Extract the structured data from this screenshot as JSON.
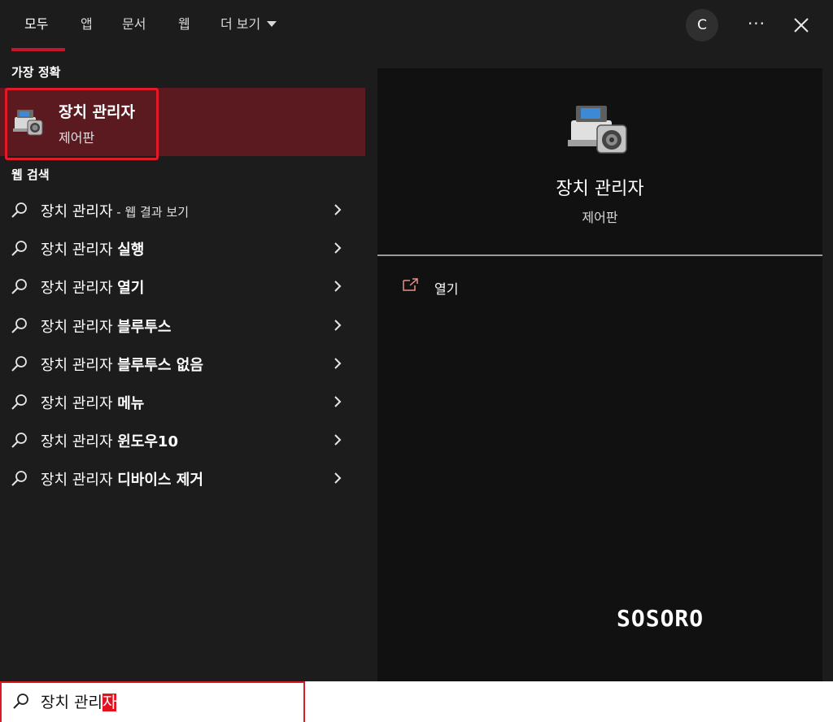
{
  "tabs": [
    {
      "label": "모두",
      "active": true
    },
    {
      "label": "앱",
      "active": false
    },
    {
      "label": "문서",
      "active": false
    },
    {
      "label": "웹",
      "active": false
    },
    {
      "label": "더 보기",
      "active": false
    }
  ],
  "account": {
    "initial": "C"
  },
  "header": {
    "more_label": "···"
  },
  "best_match": {
    "section_label": "가장 정확",
    "title": "장치 관리자",
    "subtitle": "제어판",
    "icon": "device-manager-icon"
  },
  "web_search": {
    "section_label": "웹 검색",
    "items": [
      {
        "prefix": "장치 관리자",
        "suffix": "",
        "hint": " - 웹 결과 보기"
      },
      {
        "prefix": "장치 관리자 ",
        "suffix": "실행",
        "hint": ""
      },
      {
        "prefix": "장치 관리자 ",
        "suffix": "열기",
        "hint": ""
      },
      {
        "prefix": "장치 관리자 ",
        "suffix": "블루투스",
        "hint": ""
      },
      {
        "prefix": "장치 관리자 ",
        "suffix": "블루투스 없음",
        "hint": ""
      },
      {
        "prefix": "장치 관리자 ",
        "suffix": "메뉴",
        "hint": ""
      },
      {
        "prefix": "장치 관리자 ",
        "suffix": "윈도우10",
        "hint": ""
      },
      {
        "prefix": "장치 관리자 ",
        "suffix": "디바이스 제거",
        "hint": ""
      }
    ]
  },
  "preview": {
    "title": "장치 관리자",
    "subtitle": "제어판",
    "open_label": "열기"
  },
  "watermark": "SOSORO",
  "search": {
    "typed": "장치 관리",
    "selected": "자"
  },
  "colors": {
    "accent": "#c5162b",
    "highlight_row": "#5a1a20",
    "outline_red": "#e11a2a",
    "background": "#1c1c1c",
    "preview_bg": "#111111"
  }
}
